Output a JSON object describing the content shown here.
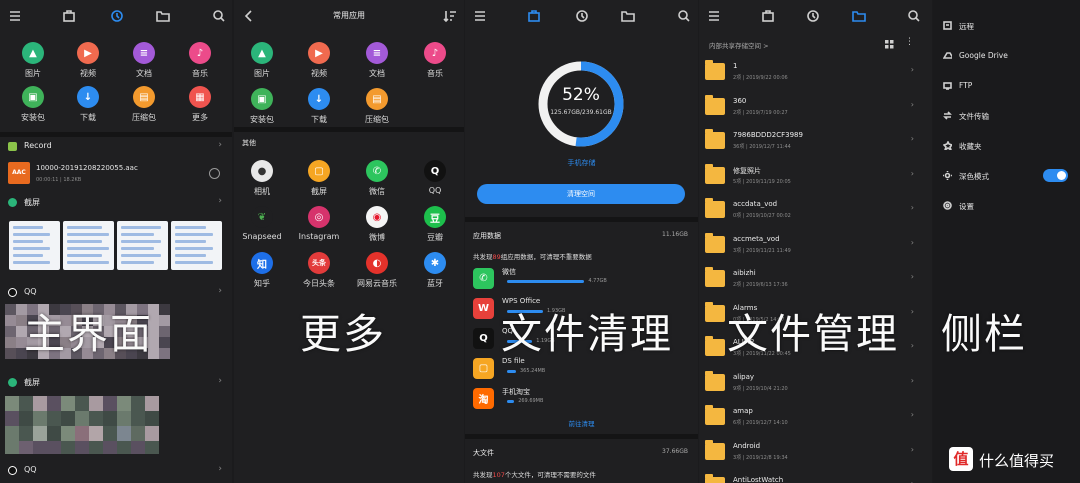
{
  "overlay_labels": {
    "p1": "主界面",
    "p2": "更多",
    "p3": "文件清理",
    "p4": "文件管理",
    "p5": "侧栏"
  },
  "watermark": "什么值得买",
  "main": {
    "categories": [
      {
        "label": "图片",
        "color": "#2bb57a",
        "glyph": "▲"
      },
      {
        "label": "视频",
        "color": "#f06a4f",
        "glyph": "▶"
      },
      {
        "label": "文档",
        "color": "#a35ad8",
        "glyph": "≡"
      },
      {
        "label": "音乐",
        "color": "#ec4b8a",
        "glyph": "♪"
      },
      {
        "label": "安装包",
        "color": "#3fb35a",
        "glyph": "▣"
      },
      {
        "label": "下载",
        "color": "#2d8cf0",
        "glyph": "↓"
      },
      {
        "label": "压缩包",
        "color": "#f39a2e",
        "glyph": "▤"
      },
      {
        "label": "更多",
        "color": "#f0544f",
        "glyph": "▦"
      }
    ],
    "record_title": "Record",
    "record_file": "10000-20191208220055.aac",
    "record_meta_time": "00:00:11",
    "record_meta_size": "18.2KB",
    "aac_label": "AAC",
    "screenshot_title": "截屏",
    "qq_title": "QQ",
    "screenshot2_title": "截屏",
    "qq2_title": "QQ"
  },
  "more": {
    "title": "常用应用",
    "top_apps": [
      {
        "label": "图片",
        "color": "#2bb57a",
        "glyph": "▲"
      },
      {
        "label": "视频",
        "color": "#f06a4f",
        "glyph": "▶"
      },
      {
        "label": "文档",
        "color": "#a35ad8",
        "glyph": "≡"
      },
      {
        "label": "音乐",
        "color": "#ec4b8a",
        "glyph": "♪"
      },
      {
        "label": "安装包",
        "color": "#3fb35a",
        "glyph": "▣"
      },
      {
        "label": "下载",
        "color": "#2d8cf0",
        "glyph": "↓"
      },
      {
        "label": "压缩包",
        "color": "#f39a2e",
        "glyph": "▤"
      }
    ],
    "other_title": "其他",
    "other_apps": [
      {
        "label": "相机",
        "color": "#e8e8e8",
        "glyph": "●",
        "fg": "#333"
      },
      {
        "label": "截屏",
        "color": "#f6a623",
        "glyph": "▢"
      },
      {
        "label": "微信",
        "color": "#2dc55e",
        "glyph": "✆"
      },
      {
        "label": "QQ",
        "color": "#111111",
        "glyph": "Q"
      },
      {
        "label": "Snapseed",
        "color": "#1f1f21",
        "glyph": "❦",
        "fg": "#4caf50"
      },
      {
        "label": "Instagram",
        "color": "#d6336c",
        "glyph": "◎"
      },
      {
        "label": "微博",
        "color": "#f5f5f5",
        "glyph": "◉",
        "fg": "#e6162d"
      },
      {
        "label": "豆瓣",
        "color": "#1dbf4c",
        "glyph": "豆"
      },
      {
        "label": "知乎",
        "color": "#1e6fe8",
        "glyph": "知"
      },
      {
        "label": "今日头条",
        "color": "#e23b3b",
        "glyph": "头条"
      },
      {
        "label": "网易云音乐",
        "color": "#e4322b",
        "glyph": "◐"
      },
      {
        "label": "蓝牙",
        "color": "#2d8cf0",
        "glyph": "✱"
      }
    ]
  },
  "clean": {
    "percent": "52%",
    "percent_value": 0.52,
    "storage": "125.67GB/239.61GB",
    "storage_label": "手机存储",
    "clean_button": "清理空间",
    "app_data_title": "应用数据",
    "app_data_size": "11.16GB",
    "found_prefix": "共发现",
    "found_count": "89",
    "found_suffix": "组应用数据，可清理不重要数据",
    "apps": [
      {
        "name": "微信",
        "size": "4.77GB",
        "bar": 0.43,
        "color": "#2dc55e",
        "glyph": "✆"
      },
      {
        "name": "WPS Office",
        "size": "1.93GB",
        "bar": 0.2,
        "color": "#e7413b",
        "glyph": "W"
      },
      {
        "name": "QQ",
        "size": "1.19GB",
        "bar": 0.14,
        "color": "#111111",
        "glyph": "Q"
      },
      {
        "name": "DS file",
        "size": "365.24MB",
        "bar": 0.05,
        "color": "#f6a623",
        "glyph": "▢"
      },
      {
        "name": "手机淘宝",
        "size": "269.69MB",
        "bar": 0.04,
        "color": "#ff6a00",
        "glyph": "淘"
      }
    ],
    "goto_clean": "前往清理",
    "big_file_title": "大文件",
    "big_file_size": "37.66GB",
    "big_prefix": "共发现",
    "big_count": "107",
    "big_suffix": "个大文件，可清理不需要的文件"
  },
  "files": {
    "breadcrumb": "内部共享存储空间 >",
    "folders": [
      {
        "name": "1",
        "meta": "2项 | 2019/9/22 00:06"
      },
      {
        "name": "360",
        "meta": "2项 | 2019/7/19 00:27"
      },
      {
        "name": "7986BDDD2CF3989",
        "meta": "36项 | 2019/12/7 11:44"
      },
      {
        "name": "修复照片",
        "meta": "5项 | 2019/11/19 20:05"
      },
      {
        "name": "accdata_vod",
        "meta": "0项 | 2019/10/27 00:02"
      },
      {
        "name": "accmeta_vod",
        "meta": "3项 | 2019/11/21 11:49"
      },
      {
        "name": "aibizhi",
        "meta": "2项 | 2019/6/13 17:36"
      },
      {
        "name": "Alarms",
        "meta": "0项 | 2019/5/2 14:07"
      },
      {
        "name": "ALIMP",
        "meta": "3项 | 2019/11/22 00:45"
      },
      {
        "name": "alipay",
        "meta": "9项 | 2019/10/4 21:20"
      },
      {
        "name": "amap",
        "meta": "6项 | 2019/12/7 14:10"
      },
      {
        "name": "Android",
        "meta": "3项 | 2019/12/8 19:34"
      },
      {
        "name": "AntiLostWatch",
        "meta": ""
      }
    ]
  },
  "sidebar": {
    "items": [
      {
        "label": "远程",
        "icon": "remote-icon"
      },
      {
        "label": "Google Drive",
        "icon": "drive-icon"
      },
      {
        "label": "FTP",
        "icon": "ftp-icon"
      },
      {
        "label": "文件传输",
        "icon": "transfer-icon"
      },
      {
        "label": "收藏夹",
        "icon": "star-icon"
      },
      {
        "label": "深色模式",
        "icon": "dark-mode-icon"
      },
      {
        "label": "设置",
        "icon": "settings-icon"
      }
    ],
    "dark_mode_on": true,
    "accent": "#2d8cf0"
  }
}
